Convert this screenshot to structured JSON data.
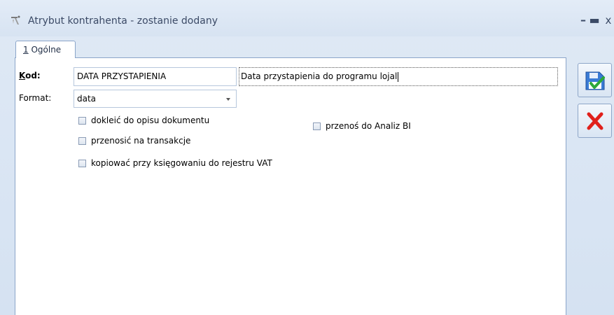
{
  "window": {
    "title": "Atrybut kontrahenta - zostanie dodany",
    "minimize_glyph": "–",
    "maximize_glyph": "▬",
    "close_glyph": "x"
  },
  "tabs": [
    {
      "accel": "1",
      "label": " Ogólne",
      "active": true
    }
  ],
  "form": {
    "kod": {
      "label_accel": "K",
      "label_rest": "od:",
      "value": "DATA PRZYSTAPIENIA"
    },
    "opis": {
      "value": "Data przystapienia do programu lojal"
    },
    "format": {
      "label": "Format:",
      "selected": "data"
    },
    "checkboxes": [
      {
        "label": "dokleić do opisu dokumentu",
        "checked": false
      },
      {
        "label": "przenosić na transakcje",
        "checked": false
      },
      {
        "label": "kopiować przy księgowaniu do rejestru VAT",
        "checked": false
      },
      {
        "label": "przenoś do Analiz BI",
        "checked": false
      }
    ]
  },
  "actions": {
    "save_icon": "save-icon",
    "cancel_icon": "cancel-icon"
  },
  "colors": {
    "accent_border": "#8ba5c9",
    "background": "#dfe9f5",
    "title_text": "#3b4a66",
    "cancel_red": "#e0201b"
  }
}
